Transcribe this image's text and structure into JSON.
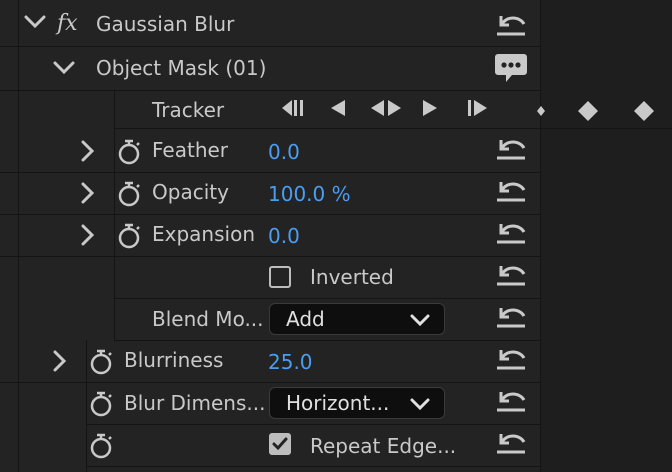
{
  "effect": {
    "fx_label": "fx",
    "name": "Gaussian Blur",
    "mask": {
      "name": "Object Mask (01)"
    },
    "tracker": {
      "label": "Tracker"
    },
    "properties": [
      {
        "label": "Feather",
        "value": "0.0"
      },
      {
        "label": "Opacity",
        "value": "100.0 %"
      },
      {
        "label": "Expansion",
        "value": "0.0"
      }
    ],
    "inverted": {
      "label": "Inverted",
      "checked": false
    },
    "blend_mode": {
      "label": "Blend Mo...",
      "value": "Add"
    },
    "blurriness": {
      "label": "Blurriness",
      "value": "25.0"
    },
    "blur_dimensions": {
      "label": "Blur Dimens...",
      "value": "Horizont..."
    },
    "repeat_edge": {
      "label": "Repeat Edge...",
      "checked": true
    }
  },
  "colors": {
    "value_blue": "#4a9df0",
    "panel": "#232323",
    "text": "#c9c9c9"
  },
  "icons": [
    "expand-chevron-icon",
    "stopwatch-icon",
    "reset-icon",
    "comment-icon",
    "keyframe-diamond-icon"
  ]
}
